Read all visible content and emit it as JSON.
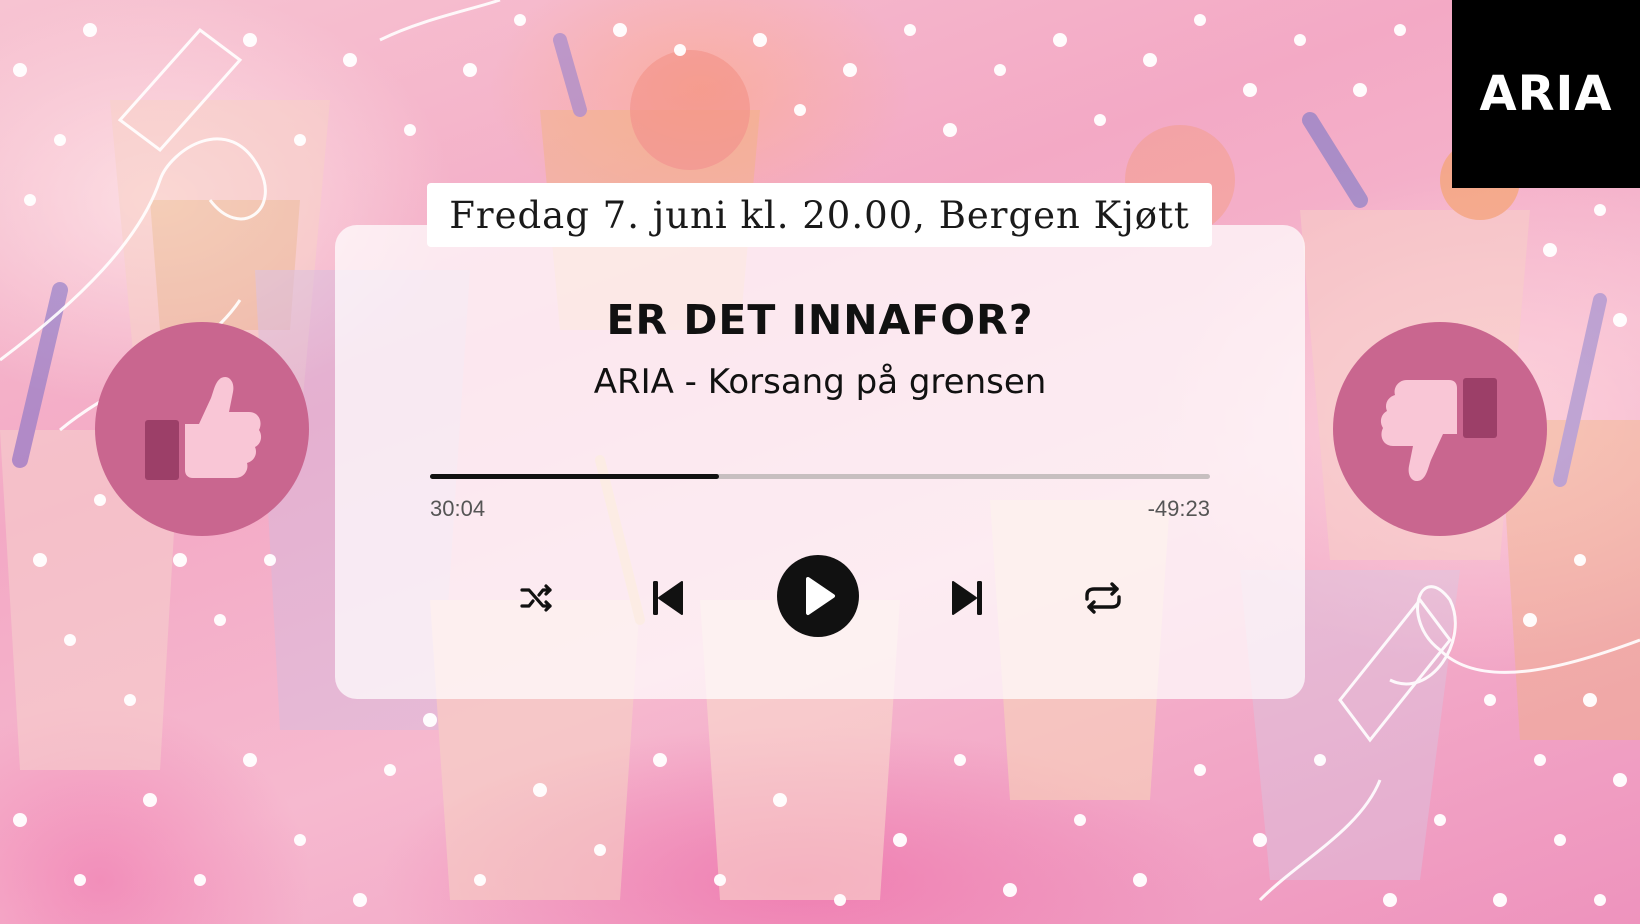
{
  "brand": {
    "logo_text": "ARIA"
  },
  "event": {
    "label": "Fredag 7. juni kl. 20.00, Bergen Kjøtt"
  },
  "player": {
    "title": "ER DET INNAFOR?",
    "artist": "ARIA - Korsang på grensen",
    "elapsed": "30:04",
    "remaining": "-49:23",
    "progress_fraction": 0.37,
    "controls": {
      "shuffle_icon": "shuffle-icon",
      "previous_icon": "skip-previous-icon",
      "play_icon": "play-icon",
      "next_icon": "skip-next-icon",
      "repeat_icon": "repeat-icon"
    }
  },
  "reactions": {
    "like_icon": "thumbs-up-icon",
    "dislike_icon": "thumbs-down-icon"
  },
  "colors": {
    "background_pink": "#f3a9c5",
    "reaction_circle": "#c9668f",
    "thumb_light": "#f9c6d6",
    "thumb_dark": "#9c3f68",
    "logo_bg": "#000000"
  }
}
